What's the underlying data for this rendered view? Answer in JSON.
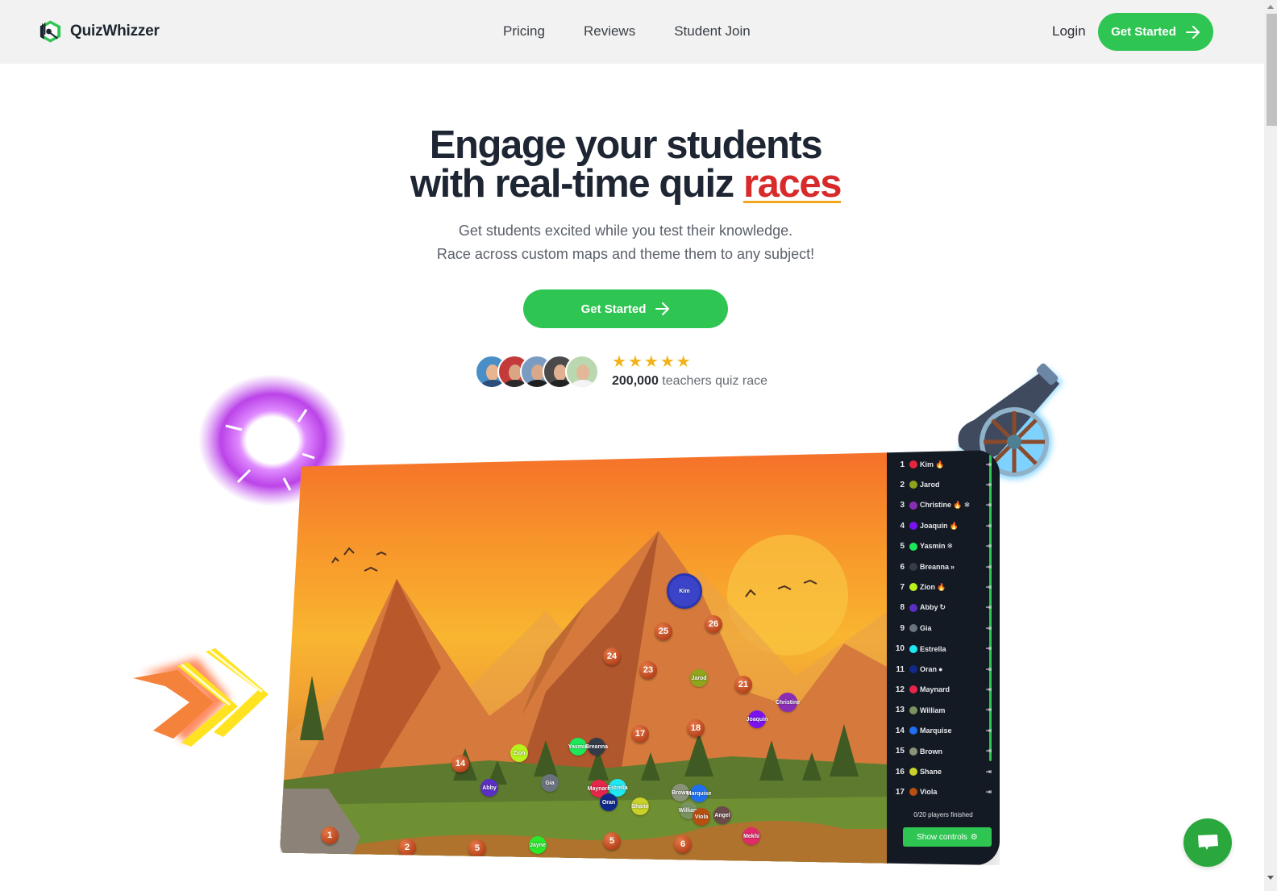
{
  "brand": {
    "name": "QuizWhizzer",
    "accent": "#2fc553",
    "highlight": "#d82a2a"
  },
  "nav": {
    "links": [
      {
        "label": "Pricing"
      },
      {
        "label": "Reviews"
      },
      {
        "label": "Student Join"
      }
    ],
    "login": "Login",
    "cta": "Get Started"
  },
  "hero": {
    "title_line1": "Engage your students",
    "title_line2_prefix": "with real-time quiz",
    "title_accent": "races",
    "subtitle_line1": "Get students excited while you test their knowledge.",
    "subtitle_line2": "Race across custom maps and theme them to any subject!",
    "cta": "Get Started"
  },
  "social_proof": {
    "stars": 5,
    "count": "200,000",
    "text": "teachers quiz race",
    "avatars": [
      "teacher-1",
      "teacher-2",
      "teacher-3",
      "teacher-4",
      "teacher-5"
    ]
  },
  "game": {
    "map_markers": [
      "1",
      "2",
      "5",
      "6",
      "5",
      "14",
      "17",
      "18",
      "21",
      "23",
      "24",
      "25",
      "26"
    ],
    "players_on_map": [
      "Kim",
      "Jarod",
      "Christine",
      "Joaquin",
      "Yasmin",
      "Breanna",
      "Zion",
      "Abby",
      "Gia",
      "Maynard",
      "Estrella",
      "Oran",
      "Shane",
      "Brown",
      "Marquise",
      "William",
      "Viola",
      "Angel",
      "Mekhi",
      "Jayne"
    ],
    "leaderboard": [
      {
        "rank": "1",
        "name": "Kim",
        "color": "#e8253f",
        "badge": "🔥"
      },
      {
        "rank": "2",
        "name": "Jarod",
        "color": "#8fa51c",
        "badge": ""
      },
      {
        "rank": "3",
        "name": "Christine",
        "color": "#8a2db5",
        "badge": "🔥 ❄"
      },
      {
        "rank": "4",
        "name": "Joaquin",
        "color": "#7a12f0",
        "badge": "🔥"
      },
      {
        "rank": "5",
        "name": "Yasmin",
        "color": "#1de85a",
        "badge": "❄"
      },
      {
        "rank": "6",
        "name": "Breanna",
        "color": "#343c48",
        "badge": "»"
      },
      {
        "rank": "7",
        "name": "Zion",
        "color": "#b8f21c",
        "badge": "🔥"
      },
      {
        "rank": "8",
        "name": "Abby",
        "color": "#5a2fc4",
        "badge": "↻"
      },
      {
        "rank": "9",
        "name": "Gia",
        "color": "#6a737d",
        "badge": ""
      },
      {
        "rank": "10",
        "name": "Estrella",
        "color": "#1ee8f2",
        "badge": ""
      },
      {
        "rank": "11",
        "name": "Oran",
        "color": "#0f2a8a",
        "badge": "●"
      },
      {
        "rank": "12",
        "name": "Maynard",
        "color": "#e8254a",
        "badge": ""
      },
      {
        "rank": "13",
        "name": "William",
        "color": "#7a9460",
        "badge": ""
      },
      {
        "rank": "14",
        "name": "Marquise",
        "color": "#1f6ff0",
        "badge": ""
      },
      {
        "rank": "15",
        "name": "Brown",
        "color": "#8a937a",
        "badge": ""
      },
      {
        "rank": "16",
        "name": "Shane",
        "color": "#c9d12a",
        "badge": ""
      },
      {
        "rank": "17",
        "name": "Viola",
        "color": "#b84f12",
        "badge": ""
      }
    ],
    "finished": "0/20 players finished",
    "controls": "Show controls"
  },
  "chat": {
    "icon": "chat-bubble-icon"
  }
}
